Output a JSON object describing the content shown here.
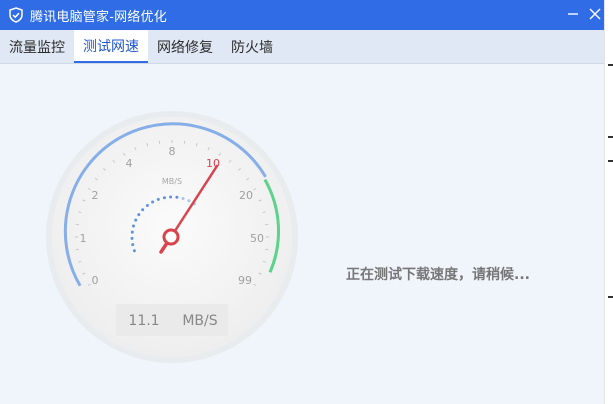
{
  "window": {
    "title": "腾讯电脑管家-网络优化",
    "minimize_icon": "minimize-icon",
    "close_icon": "close-icon",
    "title_bar_color": "#2f6ce5"
  },
  "tabs": [
    {
      "label": "流量监控",
      "active": false
    },
    {
      "label": "测试网速",
      "active": true
    },
    {
      "label": "网络修复",
      "active": false
    },
    {
      "label": "防火墙",
      "active": false
    }
  ],
  "gauge": {
    "unit": "MB/S",
    "ticks": [
      "0",
      "1",
      "2",
      "4",
      "8",
      "10",
      "20",
      "50",
      "99"
    ],
    "needle_tick": "10",
    "readout": {
      "value": "11.1",
      "unit": "MB/S"
    },
    "colors": {
      "arc_blue": "#86aee8",
      "arc_green": "#5cd28a",
      "needle": "#d8434c",
      "tick_highlight": "#d8434c"
    }
  },
  "status_text": "正在测试下载速度，请稍候..."
}
